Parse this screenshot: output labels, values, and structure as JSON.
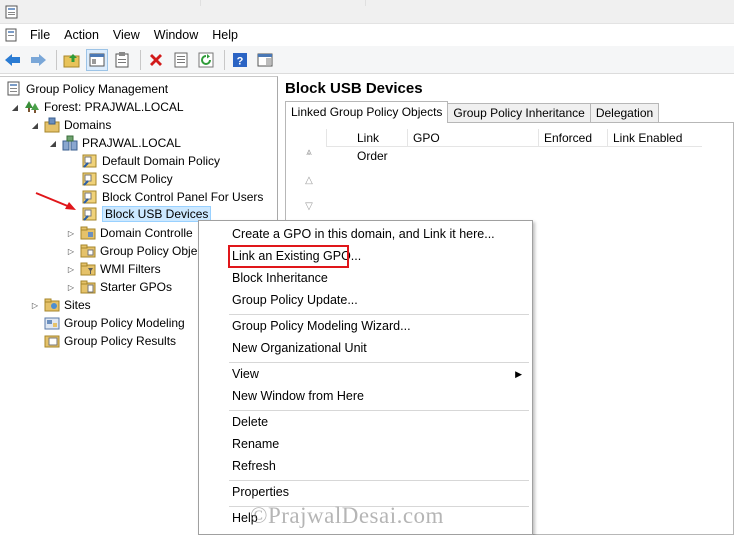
{
  "menubar": {
    "items": [
      "File",
      "Action",
      "View",
      "Window",
      "Help"
    ]
  },
  "toolbar": {
    "buttons": [
      "back-icon",
      "forward-icon",
      "up-folder-icon",
      "show-hide-tree-icon",
      "properties-icon",
      "delete-icon",
      "export-list-icon",
      "refresh-icon",
      "help-icon",
      "action-pane-icon"
    ]
  },
  "tree": {
    "root": "Group Policy Management",
    "forest": "Forest: PRAJWAL.LOCAL",
    "domains": "Domains",
    "domain": "PRAJWAL.LOCAL",
    "gpos": [
      "Default Domain Policy",
      "SCCM Policy",
      "Block Control Panel For Users",
      "Block USB Devices"
    ],
    "containers": [
      "Domain Controlle",
      "Group Policy Obje",
      "WMI Filters",
      "Starter GPOs"
    ],
    "sites": "Sites",
    "modeling": "Group Policy Modeling",
    "results": "Group Policy Results"
  },
  "right": {
    "title": "Block USB Devices",
    "tabs": [
      "Linked Group Policy Objects",
      "Group Policy Inheritance",
      "Delegation"
    ],
    "columns": [
      "Link Order",
      "GPO",
      "Enforced",
      "Link Enabled"
    ]
  },
  "context_menu": {
    "items": [
      "Create a GPO in this domain, and Link it here...",
      "Link an Existing GPO...",
      "Block Inheritance",
      "Group Policy Update...",
      "Group Policy Modeling Wizard...",
      "New Organizational Unit",
      "View",
      "New Window from Here",
      "Delete",
      "Rename",
      "Refresh",
      "Properties",
      "Help"
    ]
  },
  "watermark": "©PrajwalDesai.com",
  "colors": {
    "selection_bg": "#cce8ff",
    "highlight_box": "#e0161a",
    "annotation_arrow": "#e0161a"
  }
}
